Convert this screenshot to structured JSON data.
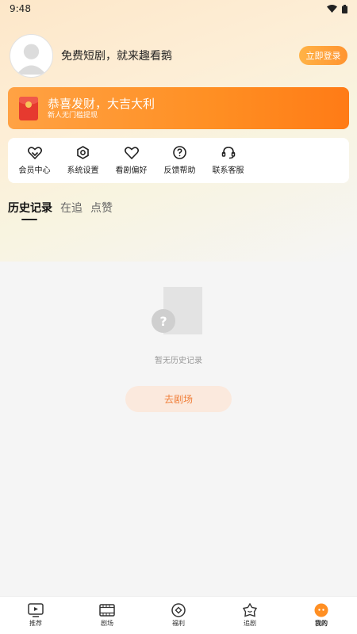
{
  "status_bar": {
    "time": "9:48"
  },
  "profile": {
    "text": "免费短剧，就来趣看鹅",
    "login_label": "立即登录"
  },
  "banner": {
    "title": "恭喜发财，大吉大利",
    "subtitle": "新人无门槛提现"
  },
  "menu": {
    "items": [
      {
        "label": "会员中心",
        "icon": "vip-heart-icon"
      },
      {
        "label": "系统设置",
        "icon": "settings-icon"
      },
      {
        "label": "看剧偏好",
        "icon": "heart-icon"
      },
      {
        "label": "反馈帮助",
        "icon": "help-icon"
      },
      {
        "label": "联系客服",
        "icon": "headset-icon"
      }
    ]
  },
  "tabs": [
    {
      "label": "历史记录",
      "active": true
    },
    {
      "label": "在追",
      "active": false
    },
    {
      "label": "点赞",
      "active": false
    }
  ],
  "empty_state": {
    "message": "暂无历史记录",
    "button_label": "去剧场"
  },
  "bottom_nav": {
    "items": [
      {
        "label": "推荐",
        "icon": "play-screen-icon",
        "active": false
      },
      {
        "label": "剧场",
        "icon": "film-icon",
        "active": false
      },
      {
        "label": "福利",
        "icon": "coin-icon",
        "active": false
      },
      {
        "label": "追剧",
        "icon": "star-face-icon",
        "active": false
      },
      {
        "label": "我的",
        "icon": "profile-face-icon",
        "active": true
      }
    ]
  },
  "colors": {
    "accent": "#ff8f23",
    "button_bg": "#fbe9dd",
    "button_text": "#f07f3a"
  }
}
